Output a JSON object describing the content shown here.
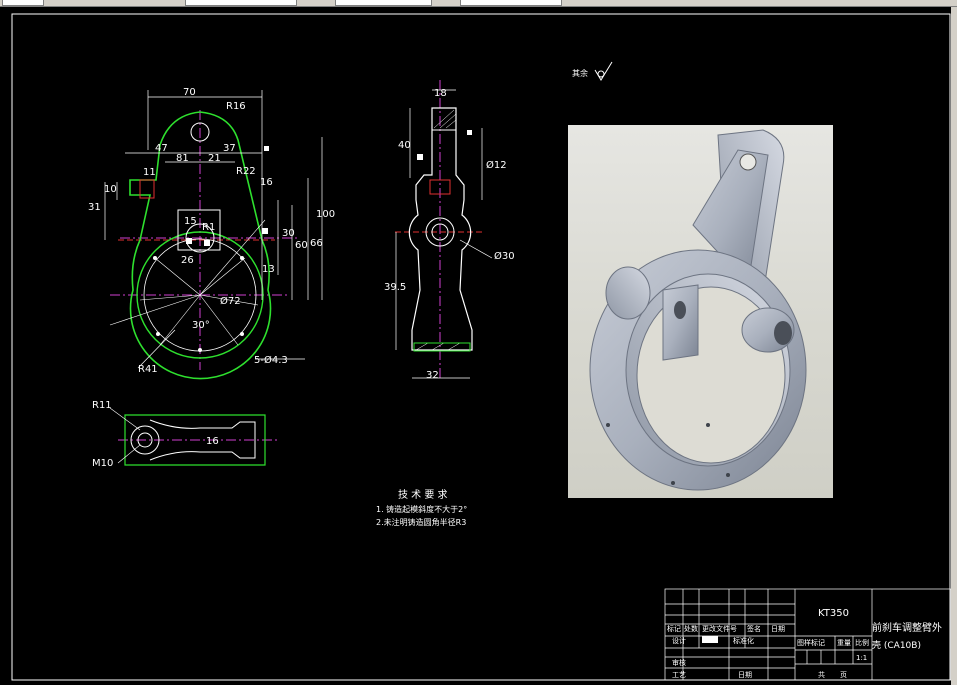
{
  "toolbar": {
    "items": [
      "",
      "",
      "",
      ""
    ]
  },
  "drawing": {
    "roughness_note": "其余",
    "tech_req": {
      "title": "技 术 要 求",
      "items": [
        "1. 铸造起模斜度不大于2°",
        "2.未注明铸造圆角半径R3"
      ]
    },
    "front_view": {
      "dims": [
        "70",
        "R16",
        "47",
        "37",
        "81",
        "21",
        "R22",
        "R1",
        "15",
        "26",
        "16",
        "30",
        "60",
        "66",
        "100",
        "13",
        "31",
        "10",
        "11",
        "Ø72",
        "R41",
        "5-Ø4.3",
        "30°"
      ]
    },
    "side_view": {
      "dims": [
        "18",
        "40",
        "Ø12",
        "Ø30",
        "39.5",
        "32"
      ]
    },
    "top_view": {
      "dims": [
        "R11",
        "M10",
        "16"
      ]
    }
  },
  "title_block": {
    "part_code": "KT350",
    "part_name_line1": "前刹车调整臂外",
    "part_name_line2": "壳 (CA10B)",
    "row_labels": [
      "标记",
      "处数",
      "更改文件号",
      "签名",
      "日期"
    ],
    "design_label": "设计",
    "std_label": "标准化",
    "check_label": "审核",
    "process_label": "工艺",
    "date_label": "日期",
    "stage_label": "图样标记",
    "weight_label": "重量",
    "scale_label": "比例",
    "scale_value": "1:1",
    "sheet_total": "共",
    "sheet_label": "页"
  }
}
